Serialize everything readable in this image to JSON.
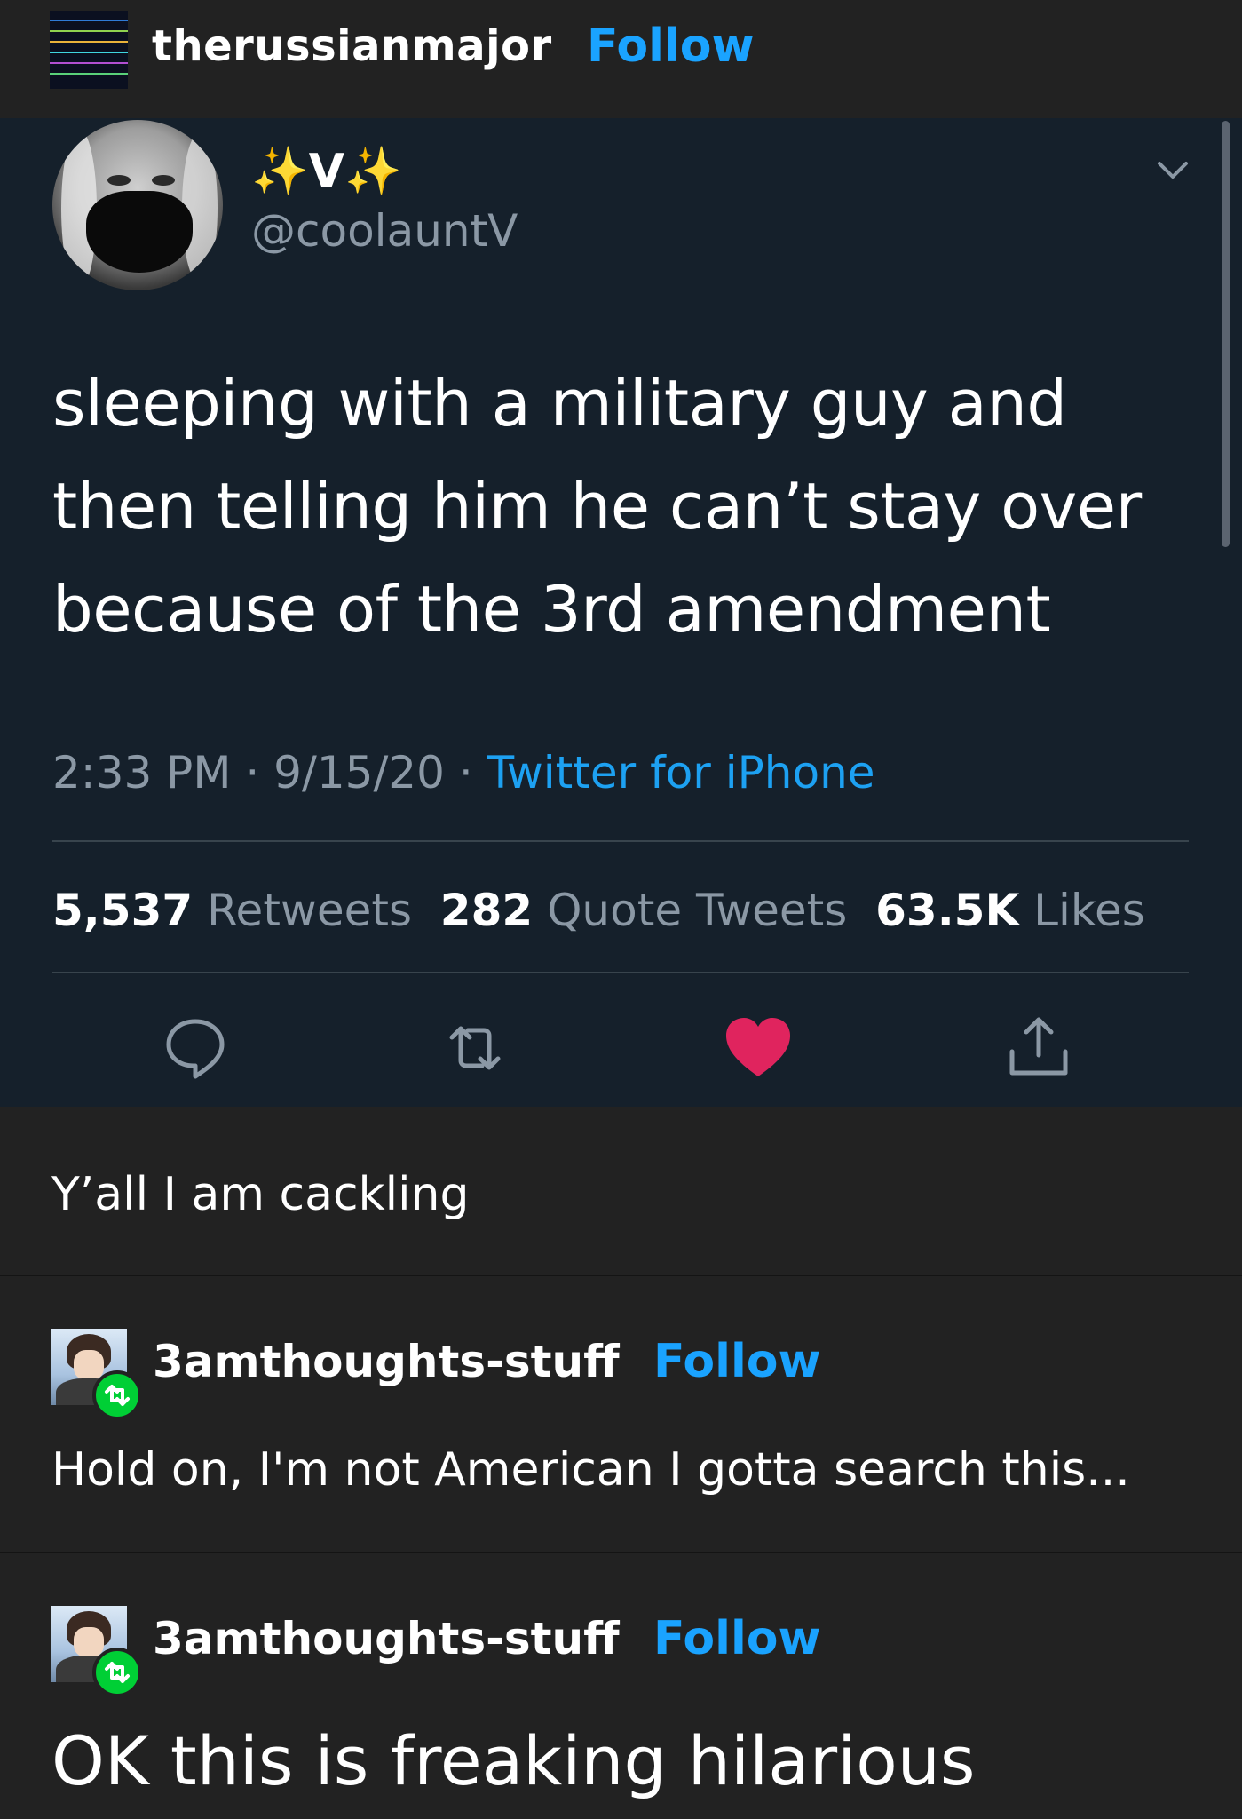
{
  "header": {
    "blog_name": "therussianmajor",
    "follow_label": "Follow"
  },
  "tweet": {
    "display_name": "V",
    "handle": "@coolauntV",
    "text": "sleeping with a military guy and then telling him he can’t stay over because of the 3rd amendment",
    "time": "2:33 PM",
    "date": "9/15/20",
    "source": "Twitter for iPhone",
    "retweets_count": "5,537",
    "retweets_label": "Retweets",
    "quotes_count": "282",
    "quotes_label": "Quote Tweets",
    "likes_count": "63.5K",
    "likes_label": "Likes",
    "like_color": "#e0245e",
    "accent_color": "#1da1f2"
  },
  "post": {
    "caption": "Y’all I am cackling"
  },
  "reblogs": [
    {
      "username": "3amthoughts-stuff",
      "follow_label": "Follow",
      "text": "Hold on, I'm not American I gotta search this..."
    },
    {
      "username": "3amthoughts-stuff",
      "follow_label": "Follow",
      "text": "OK this is freaking hilarious"
    }
  ]
}
